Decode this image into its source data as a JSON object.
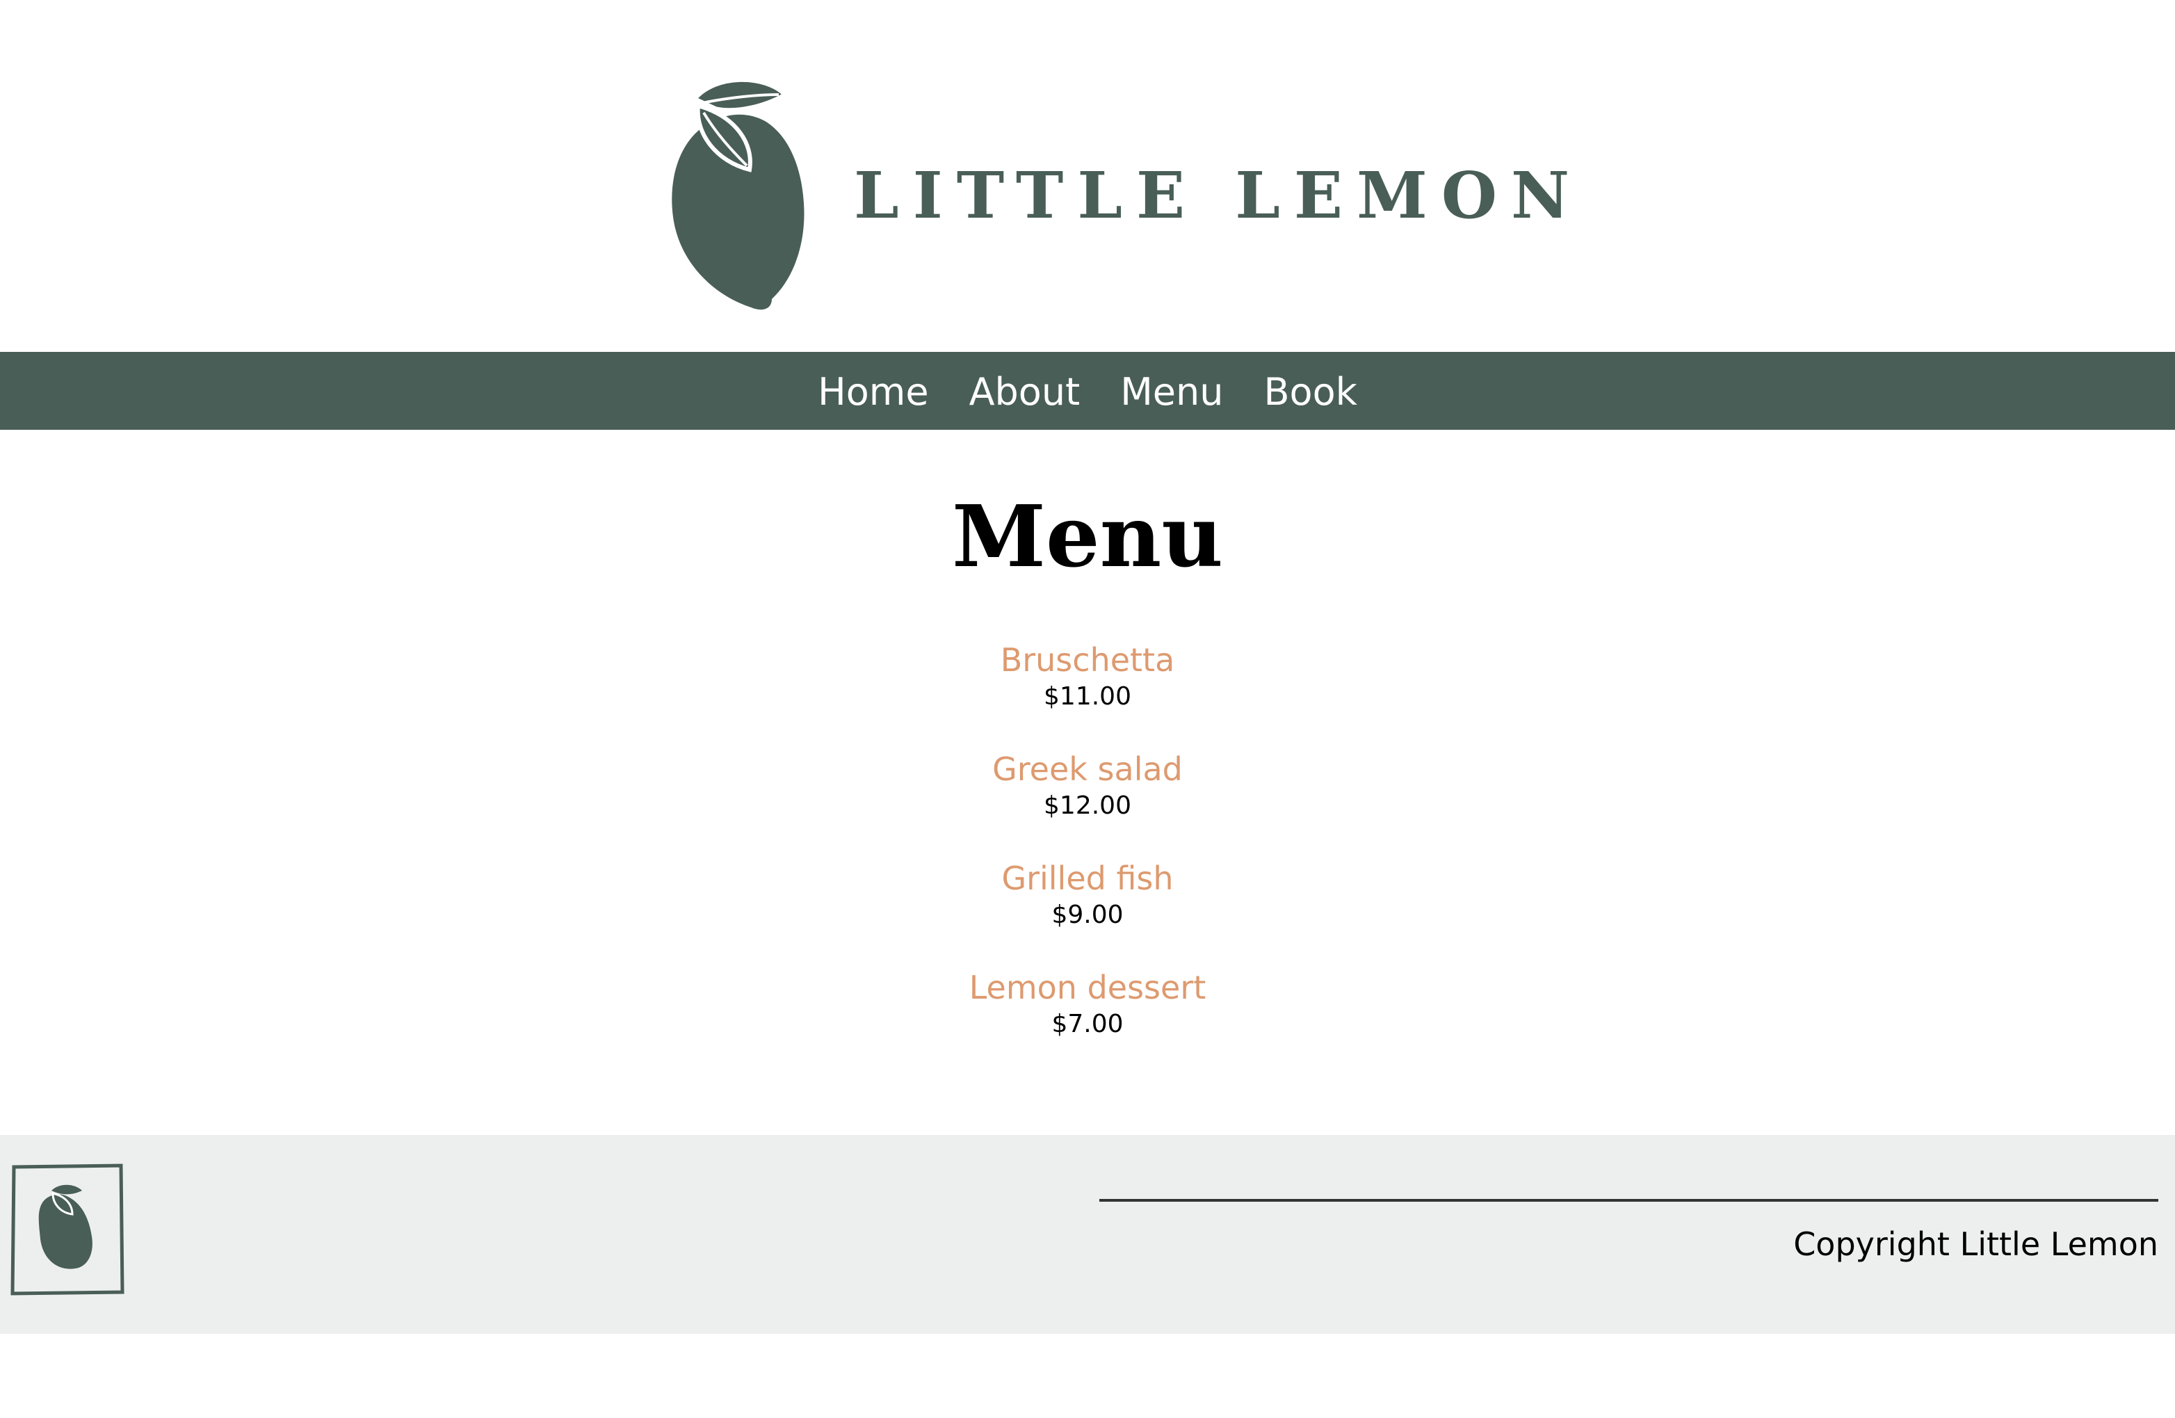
{
  "header": {
    "brand": "LITTLE LEMON",
    "logo_icon": "lemon-icon"
  },
  "nav": {
    "items": [
      {
        "label": "Home"
      },
      {
        "label": "About"
      },
      {
        "label": "Menu"
      },
      {
        "label": "Book"
      }
    ]
  },
  "main": {
    "title": "Menu",
    "items": [
      {
        "name": "Bruschetta",
        "price": "$11.00"
      },
      {
        "name": "Greek salad",
        "price": "$12.00"
      },
      {
        "name": "Grilled fish",
        "price": "$9.00"
      },
      {
        "name": "Lemon dessert",
        "price": "$7.00"
      }
    ]
  },
  "footer": {
    "logo_icon": "lemon-icon",
    "copyright": "Copyright Little Lemon"
  },
  "colors": {
    "brand_green": "#495e57",
    "accent_orange": "#dd9a6f",
    "footer_bg": "#edefee"
  }
}
